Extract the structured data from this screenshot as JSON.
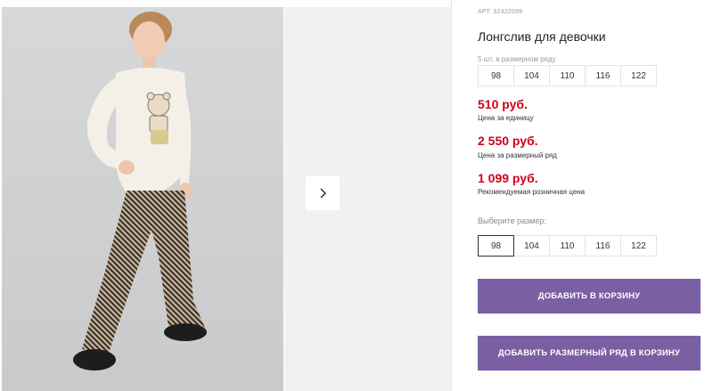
{
  "gallery": {
    "next_icon": "chevron-right-icon"
  },
  "product": {
    "article": "АРТ. 32422099",
    "title": "Лонгслив для девочки",
    "series_caption": "5 шт. в размерном ряду",
    "series_sizes": [
      "98",
      "104",
      "110",
      "116",
      "122"
    ],
    "prices": [
      {
        "value": "510 руб.",
        "label": "Цена за единицу"
      },
      {
        "value": "2 550 руб.",
        "label": "Цена за размерный ряд"
      },
      {
        "value": "1 099 руб.",
        "label": "Рекомендуемая розничная цена"
      }
    ],
    "choose_size_label": "Выберите размер:",
    "sizes": [
      "98",
      "104",
      "110",
      "116",
      "122"
    ],
    "selected_size": "98",
    "add_to_cart": "ДОБАВИТЬ В КОРЗИНУ",
    "add_series_to_cart": "ДОБАВИТЬ РАЗМЕРНЫЙ РЯД В КОРЗИНУ"
  },
  "colors": {
    "price": "#d0021b",
    "cta": "#7a60a3"
  }
}
